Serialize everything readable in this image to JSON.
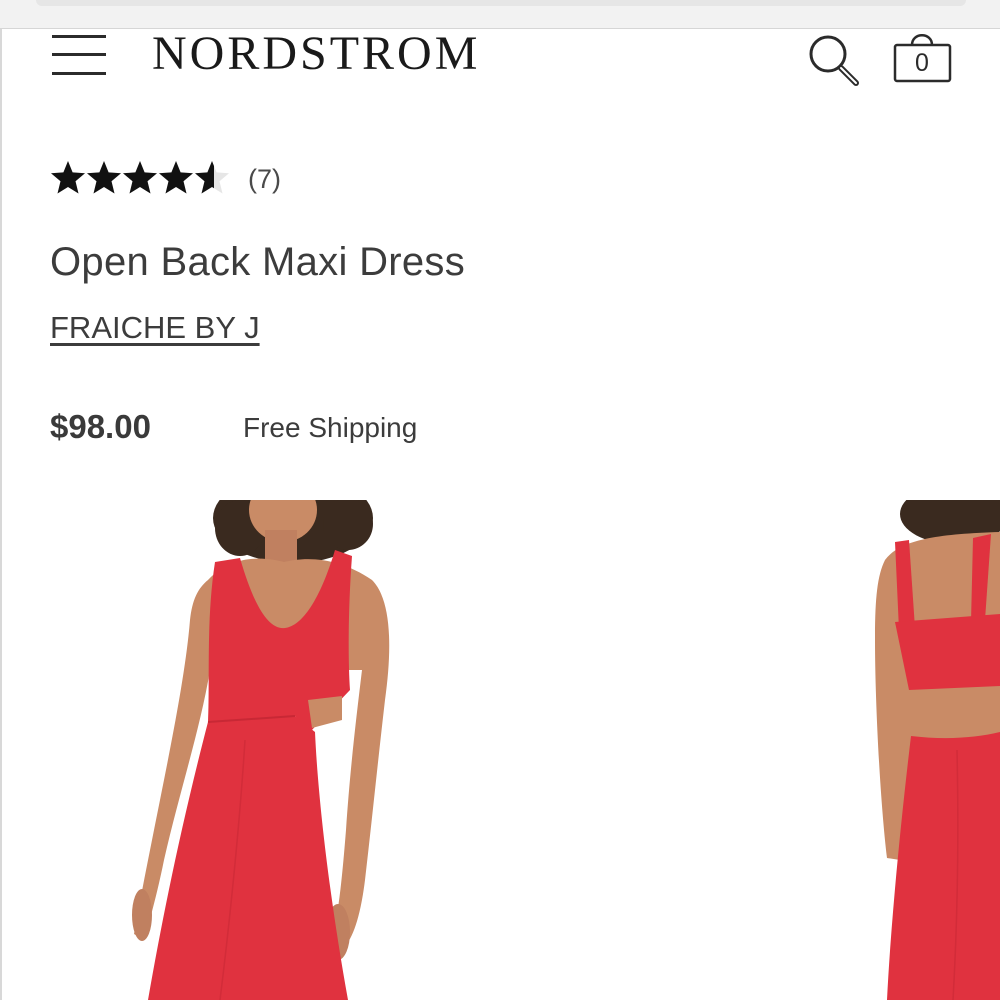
{
  "header": {
    "logo": "NORDSTROM",
    "bag_count": "0",
    "menu_icon": "hamburger-menu-icon",
    "search_icon": "magnifier-icon",
    "bag_icon": "shopping-bag-icon"
  },
  "product": {
    "rating_value": 4.5,
    "rating_max": 5,
    "review_count": "(7)",
    "title": "Open Back Maxi Dress",
    "brand": "FRAICHE BY J",
    "price": "$98.00",
    "shipping": "Free Shipping"
  },
  "colors": {
    "dress": "#e0323f",
    "text": "#3c3c3c",
    "star": "#111111"
  }
}
